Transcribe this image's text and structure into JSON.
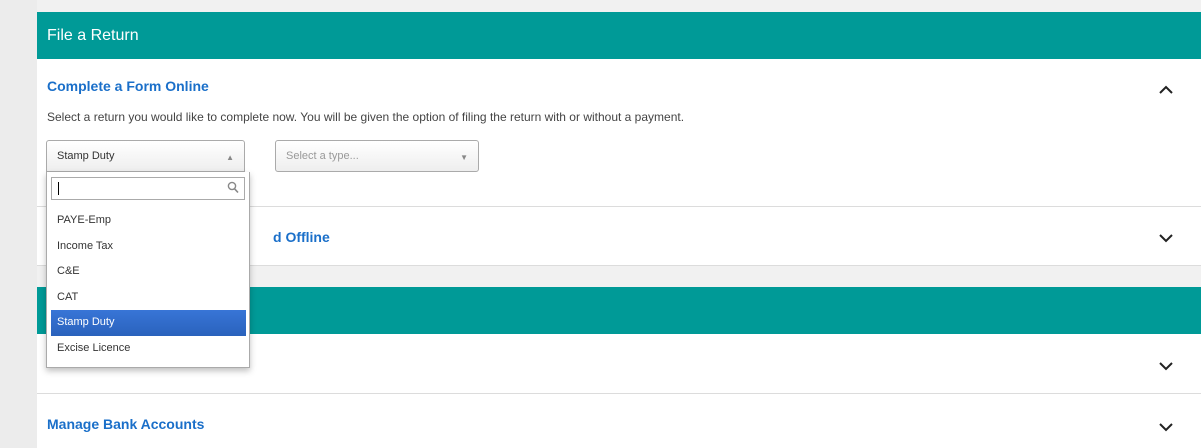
{
  "file_return": {
    "header": "File a Return",
    "complete_online": {
      "title": "Complete a Form Online",
      "description": "Select a return you would like to complete now. You will be given the option of filing the return with or without a payment.",
      "form_select": {
        "value": "Stamp Duty"
      },
      "type_select": {
        "placeholder": "Select a type..."
      },
      "dropdown": {
        "search_value": "",
        "options": [
          "PAYE-Emp",
          "Income Tax",
          "C&E",
          "CAT",
          "Stamp Duty",
          "Excise Licence"
        ],
        "selected": "Stamp Duty"
      }
    },
    "offline": {
      "title_visible_part": "d Offline"
    }
  },
  "second_panel": {
    "header": "",
    "payments_title_visible": "",
    "bank_accounts_title": "Manage Bank Accounts"
  },
  "colors": {
    "teal": "#009a97",
    "link_blue": "#1a6fc9",
    "selected_blue": "#3875d7"
  },
  "icons": {
    "expanded": "chevron-up-icon",
    "collapsed": "chevron-down-icon",
    "search": "search-icon"
  }
}
